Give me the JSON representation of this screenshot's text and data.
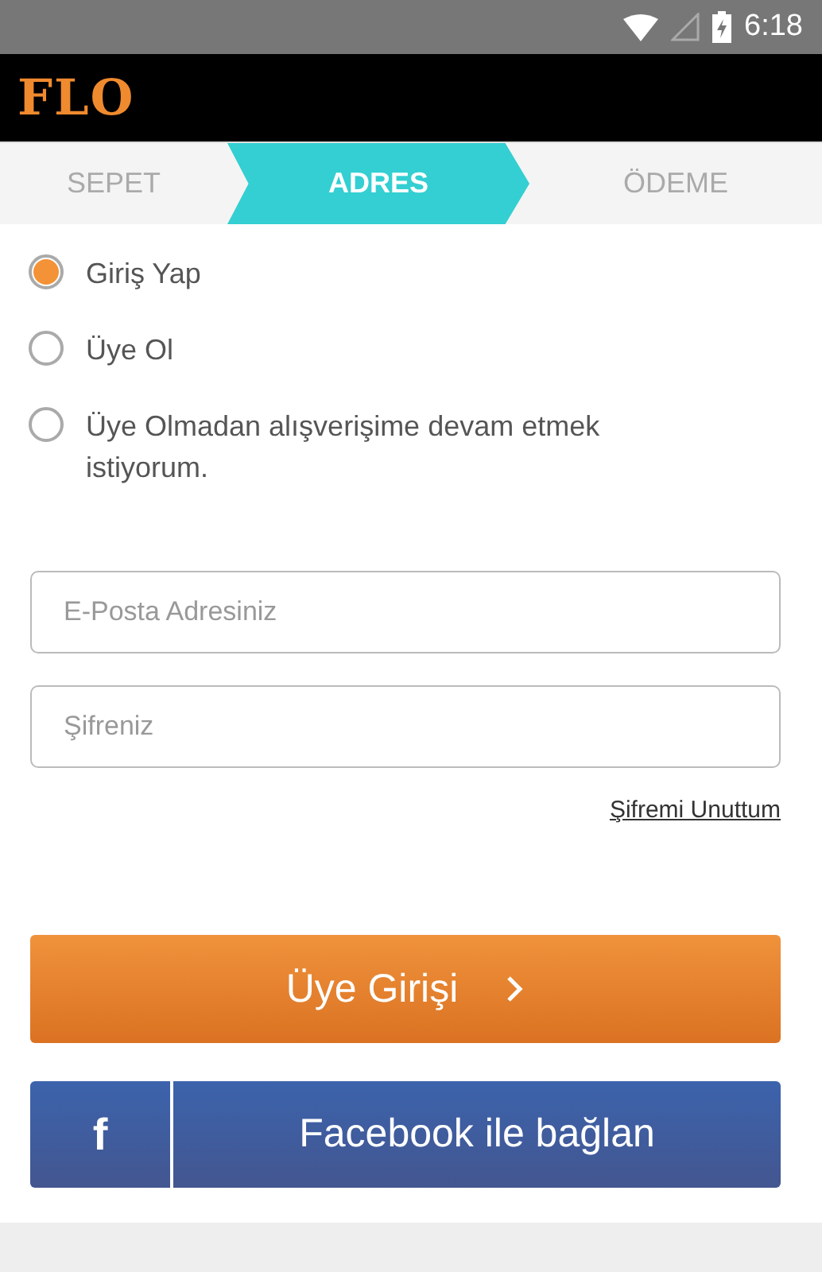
{
  "status_bar": {
    "time": "6:18"
  },
  "header": {
    "logo": "FLO"
  },
  "steps": [
    {
      "label": "SEPET",
      "selected": false
    },
    {
      "label": "ADRES",
      "selected": true
    },
    {
      "label": "ÖDEME",
      "selected": false
    }
  ],
  "options": [
    {
      "label": "Giriş Yap",
      "selected": true
    },
    {
      "label": "Üye Ol",
      "selected": false
    },
    {
      "label": "Üye Olmadan alışverişime devam etmek istiyorum.",
      "selected": false
    }
  ],
  "fields": [
    {
      "placeholder": "E-Posta Adresiniz"
    },
    {
      "placeholder": "Şifreniz"
    }
  ],
  "forgot_link": "Şifremi Unuttum",
  "login_button": {
    "label": "Üye Girişi"
  },
  "facebook_button": {
    "glyph": "f",
    "label": "Facebook ile bağlan"
  }
}
